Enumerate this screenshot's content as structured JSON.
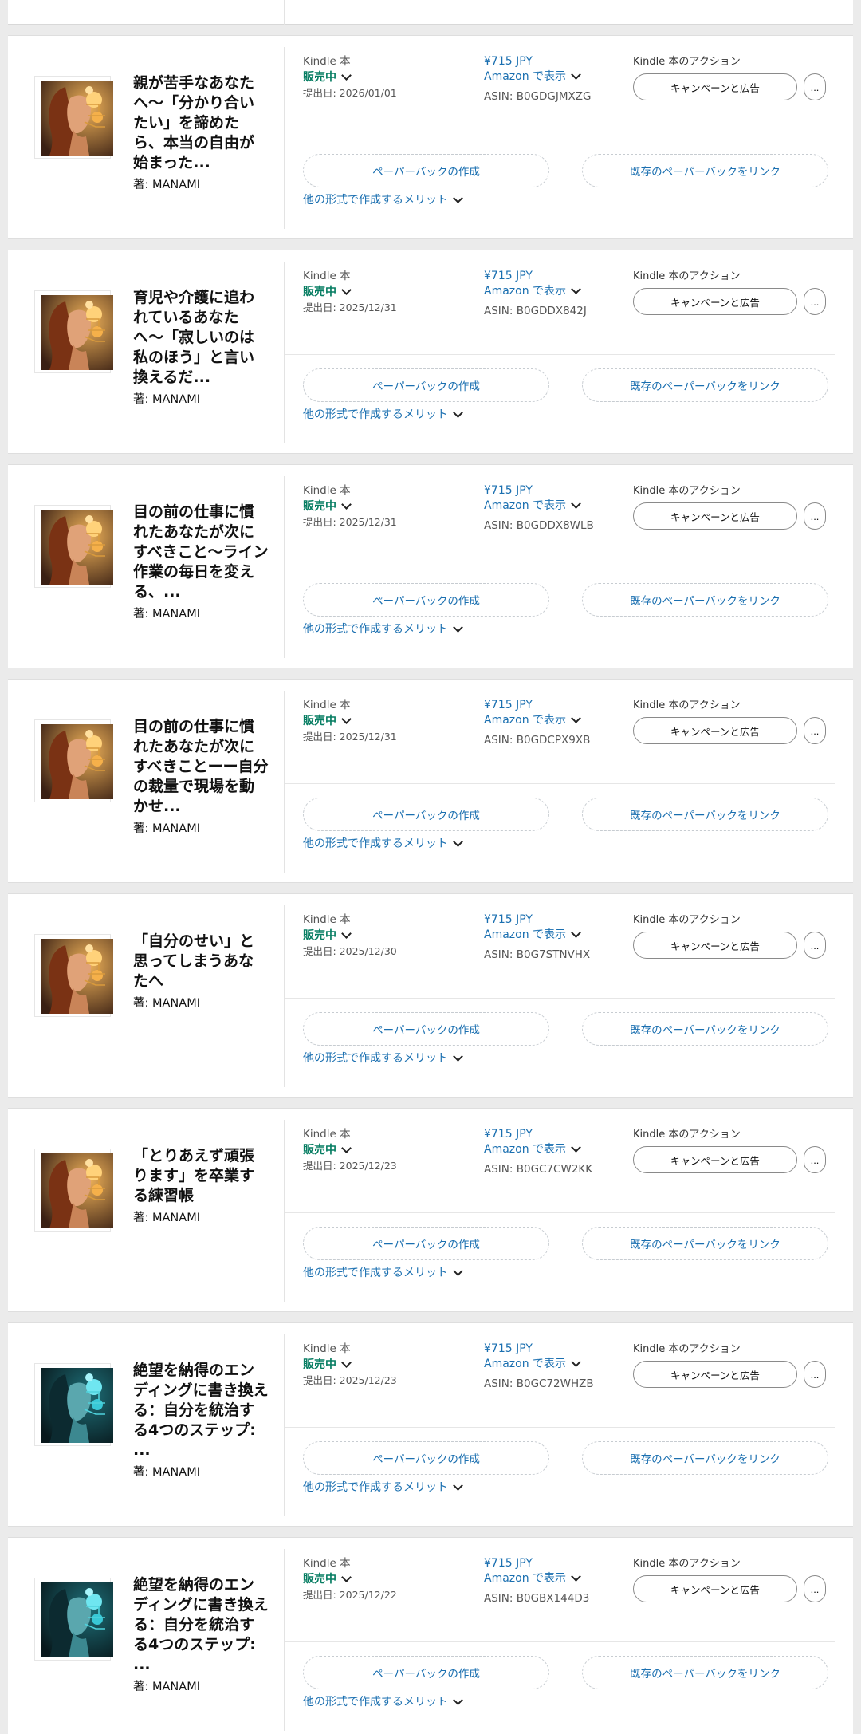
{
  "labels": {
    "format": "Kindle 本",
    "actions": "Kindle 本のアクション",
    "campaign": "キャンペーンと広告",
    "more": "...",
    "create_paperback": "ペーパーバックの作成",
    "link_paperback": "既存のペーパーバックをリンク",
    "benefits": "他の形式で作成するメリット",
    "view_amazon": "Amazon で表示"
  },
  "books": [
    {
      "title": "親が苦手なあなたへ〜「分かり合いたい」を諦めたら、本当の自由が始まった...",
      "author": "著: MANAMI",
      "status": "販売中",
      "date": "提出日: 2026/01/01",
      "price": "¥715 JPY",
      "asin": "ASIN: B0GDGJMXZG",
      "cover": "warm"
    },
    {
      "title": "育児や介護に追われているあなたへ〜「寂しいのは私のほう」と言い換えるだ...",
      "author": "著: MANAMI",
      "status": "販売中",
      "date": "提出日: 2025/12/31",
      "price": "¥715 JPY",
      "asin": "ASIN: B0GDDX842J",
      "cover": "warm"
    },
    {
      "title": "目の前の仕事に慣れたあなたが次にすべきこと〜ライン作業の毎日を変える、...",
      "author": "著: MANAMI",
      "status": "販売中",
      "date": "提出日: 2025/12/31",
      "price": "¥715 JPY",
      "asin": "ASIN: B0GDDX8WLB",
      "cover": "warm"
    },
    {
      "title": "目の前の仕事に慣れたあなたが次にすべきことーー自分の裁量で現場を動かせ...",
      "author": "著: MANAMI",
      "status": "販売中",
      "date": "提出日: 2025/12/31",
      "price": "¥715 JPY",
      "asin": "ASIN: B0GDCPX9XB",
      "cover": "warm"
    },
    {
      "title": "「自分のせい」と思ってしまうあなたへ",
      "author": "著: MANAMI",
      "status": "販売中",
      "date": "提出日: 2025/12/30",
      "price": "¥715 JPY",
      "asin": "ASIN: B0G7STNVHX",
      "cover": "warm"
    },
    {
      "title": "「とりあえず頑張ります」を卒業する練習帳",
      "author": "著: MANAMI",
      "status": "販売中",
      "date": "提出日: 2025/12/23",
      "price": "¥715 JPY",
      "asin": "ASIN: B0GC7CW2KK",
      "cover": "warm"
    },
    {
      "title": "絶望を納得のエンディングに書き換える：自分を統治する4つのステップ: ...",
      "author": "著: MANAMI",
      "status": "販売中",
      "date": "提出日: 2025/12/23",
      "price": "¥715 JPY",
      "asin": "ASIN: B0GC72WHZB",
      "cover": "teal"
    },
    {
      "title": "絶望を納得のエンディングに書き換える：自分を統治する4つのステップ: ...",
      "author": "著: MANAMI",
      "status": "販売中",
      "date": "提出日: 2025/12/22",
      "price": "¥715 JPY",
      "asin": "ASIN: B0GBX144D3",
      "cover": "teal"
    }
  ],
  "colors": {
    "link": "#1a6fb0",
    "status": "#067d62",
    "warm_cover_bg": "#3a2014",
    "teal_cover_bg": "#08181c"
  }
}
